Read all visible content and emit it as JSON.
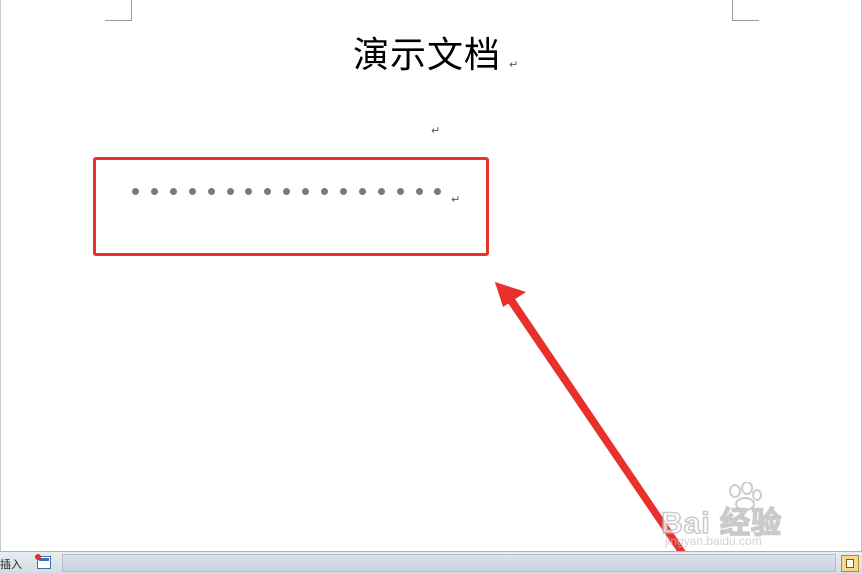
{
  "document": {
    "title": "演示文档",
    "paragraph_mark": "↵",
    "dot_leader_count": 17
  },
  "annotation": {
    "box_color": "#e8302c",
    "arrow_color": "#e8302c"
  },
  "watermark": {
    "brand": "Bai 经验",
    "url": "jingyan.baidu.com"
  },
  "statusbar": {
    "mode_label": "插入",
    "macro_icon": "macro-record-icon",
    "view_icon": "print-layout-icon"
  }
}
